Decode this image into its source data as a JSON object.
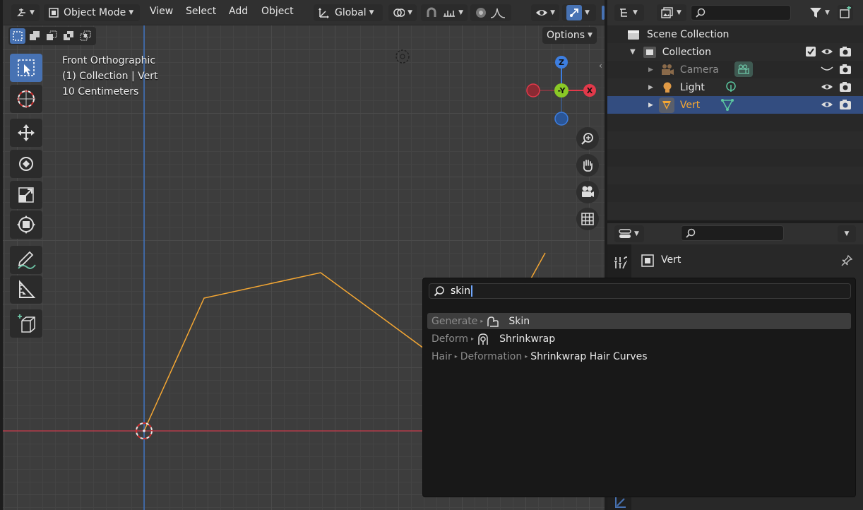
{
  "header": {
    "mode_label": "Object Mode",
    "menus": [
      "View",
      "Select",
      "Add",
      "Object"
    ],
    "orientation_label": "Global",
    "options_label": "Options"
  },
  "viewport": {
    "view_name": "Front Orthographic",
    "collection_info": "(1) Collection | Vert",
    "scale_info": "10 Centimeters",
    "gizmo": {
      "z": "Z",
      "y": "-Y",
      "x": "X"
    }
  },
  "outliner": {
    "rows": [
      {
        "label": "Scene Collection"
      },
      {
        "label": "Collection"
      },
      {
        "label": "Camera"
      },
      {
        "label": "Light"
      },
      {
        "label": "Vert"
      }
    ]
  },
  "properties": {
    "object_name": "Vert"
  },
  "search_popup": {
    "query": "skin",
    "results": [
      {
        "path": [
          "Generate"
        ],
        "label": "Skin"
      },
      {
        "path": [
          "Deform"
        ],
        "label": "Shrinkwrap"
      },
      {
        "path": [
          "Hair",
          "Deformation"
        ],
        "label": "Shrinkwrap Hair Curves"
      }
    ]
  },
  "colors": {
    "accent": "#4772b3",
    "selection_orange": "#f5a733",
    "axis_x": "#e2394a",
    "axis_y": "#8ac926",
    "axis_z": "#3d7ee0"
  }
}
